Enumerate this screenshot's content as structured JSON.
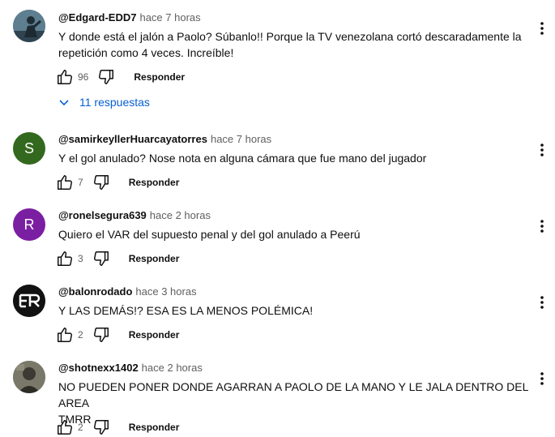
{
  "comments": [
    {
      "author": "@Edgard-EDD7",
      "time": "hace 7 horas",
      "text_lines": [
        "Y donde está el jalón a Paolo? Súbanlo!! Porque la TV venezolana cortó descaradamente la",
        "repetición como 4 veces. Increíble!"
      ],
      "likes": "96",
      "reply_label": "Responder",
      "replies_label": "11 respuestas",
      "avatar_icon": "photo-avatar"
    },
    {
      "author": "@samirkeyllerHuarcayatorres",
      "time": "hace 7 horas",
      "text_lines": [
        "Y el gol anulado? Nose nota en alguna cámara que fue mano del jugador"
      ],
      "likes": "7",
      "reply_label": "Responder",
      "avatar_letter": "S",
      "avatar_color": "#33691e"
    },
    {
      "author": "@ronelsegura639",
      "time": "hace 2 horas",
      "text_lines": [
        "Quiero el VAR del supuesto penal y del gol anulado a Peerú"
      ],
      "likes": "3",
      "reply_label": "Responder",
      "avatar_letter": "R",
      "avatar_color": "#7b1fa2"
    },
    {
      "author": "@balonrodado",
      "time": "hace 3 horas",
      "text_lines": [
        "Y LAS DEMÁS!? ESA ES LA MENOS POLÉMICA!"
      ],
      "likes": "2",
      "reply_label": "Responder",
      "avatar_icon": "logo-avatar"
    },
    {
      "author": "@shotnexx1402",
      "time": "hace 2 horas",
      "text_lines": [
        "NO PUEDEN PONER DONDE AGARRAN A PAOLO DE LA MANO Y LE JALA DENTRO DEL AREA",
        "TMRR"
      ],
      "likes": "2",
      "reply_label": "Responder",
      "avatar_icon": "photo-avatar"
    }
  ],
  "colors": {
    "link_blue": "#065fd4",
    "secondary_text": "#606060"
  }
}
